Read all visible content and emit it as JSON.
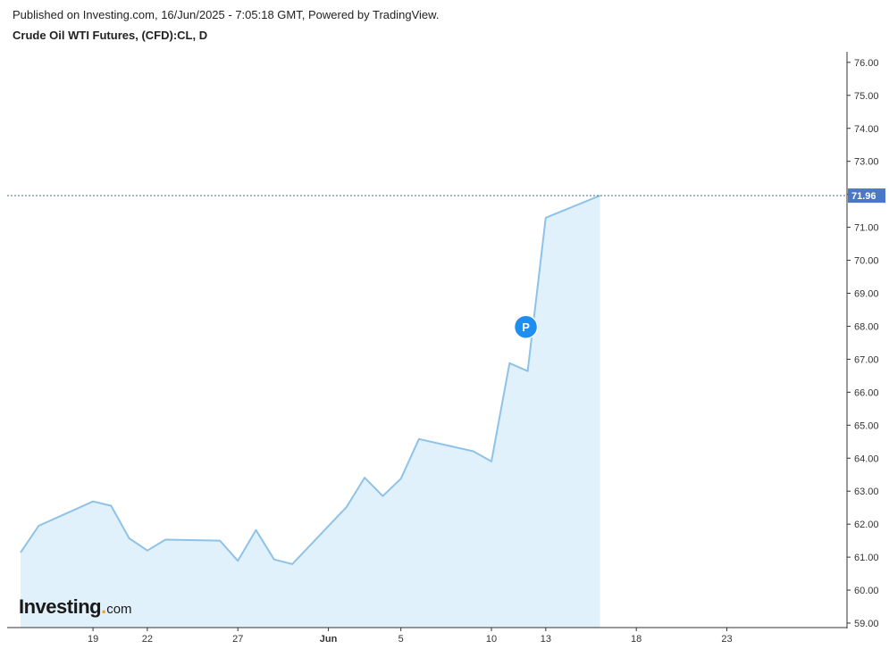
{
  "header": {
    "published": "Published on Investing.com, 16/Jun/2025 - 7:05:18 GMT, Powered by TradingView.",
    "title": "Crude Oil WTI Futures, (CFD):CL, D"
  },
  "marker_label": "P",
  "logo": {
    "main": "Investing",
    "dot": ".",
    "suffix": "com"
  },
  "colors": {
    "line": "#8ec2e8",
    "fill": "#e1f1fb",
    "last_price_line": "#4a6aa0",
    "last_price_badge": "#4a78c6",
    "marker": "#1e8ff0"
  },
  "chart_data": {
    "type": "area",
    "title": "Crude Oil WTI Futures, (CFD):CL, D",
    "xlabel": "",
    "ylabel": "",
    "ylim": [
      58.8,
      76.3
    ],
    "grid": false,
    "y_ticks": [
      "59.00",
      "60.00",
      "61.00",
      "62.00",
      "63.00",
      "64.00",
      "65.00",
      "66.00",
      "67.00",
      "68.00",
      "69.00",
      "70.00",
      "71.00",
      "72.00",
      "73.00",
      "74.00",
      "75.00",
      "76.00"
    ],
    "x_ticks": [
      {
        "date": "2025-05-19",
        "label": "19"
      },
      {
        "date": "2025-05-22",
        "label": "22"
      },
      {
        "date": "2025-05-27",
        "label": "27"
      },
      {
        "date": "2025-06-01",
        "label": "Jun",
        "bold": true
      },
      {
        "date": "2025-06-05",
        "label": "5"
      },
      {
        "date": "2025-06-10",
        "label": "10"
      },
      {
        "date": "2025-06-13",
        "label": "13"
      },
      {
        "date": "2025-06-18",
        "label": "18"
      },
      {
        "date": "2025-06-23",
        "label": "23"
      }
    ],
    "x_range": [
      "2025-05-15",
      "2025-06-23"
    ],
    "x": [
      "2025-05-15",
      "2025-05-16",
      "2025-05-19",
      "2025-05-20",
      "2025-05-21",
      "2025-05-22",
      "2025-05-23",
      "2025-05-26",
      "2025-05-27",
      "2025-05-28",
      "2025-05-29",
      "2025-05-30",
      "2025-06-02",
      "2025-06-03",
      "2025-06-04",
      "2025-06-05",
      "2025-06-06",
      "2025-06-09",
      "2025-06-10",
      "2025-06-11",
      "2025-06-12",
      "2025-06-13",
      "2025-06-16"
    ],
    "values": [
      61.14,
      61.95,
      62.69,
      62.56,
      61.57,
      61.2,
      61.53,
      61.5,
      60.89,
      61.82,
      60.93,
      60.79,
      62.52,
      63.41,
      62.85,
      63.38,
      64.58,
      64.21,
      63.9,
      66.88,
      66.64,
      71.29,
      71.96
    ],
    "last_price": 71.96,
    "last_price_label": "71.96",
    "marker": {
      "date": "2025-06-12",
      "y": 67.98
    }
  }
}
